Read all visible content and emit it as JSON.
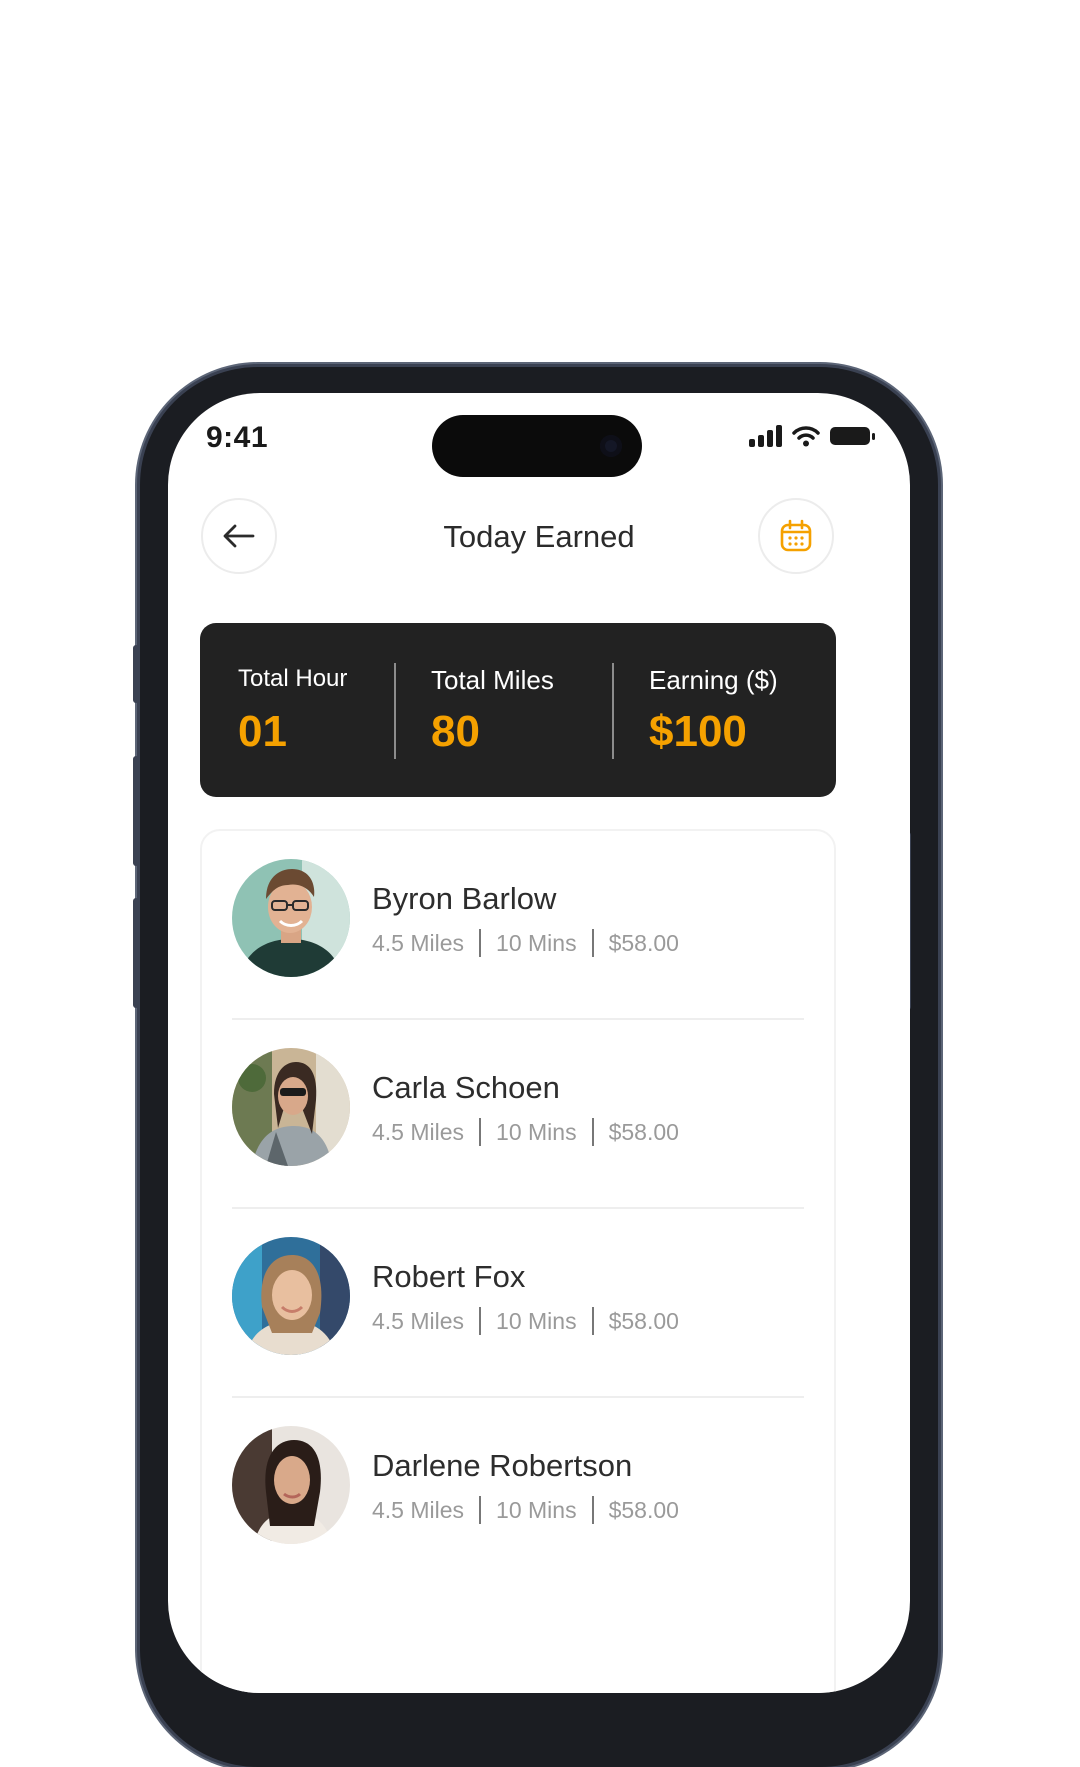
{
  "status_bar": {
    "time": "9:41"
  },
  "header": {
    "title": "Today Earned",
    "back_icon": "arrow-left-icon",
    "calendar_icon": "calendar-icon"
  },
  "colors": {
    "accent": "#F5A100",
    "card_dark": "#222222"
  },
  "stats": [
    {
      "label": "Total Hour",
      "value": "01"
    },
    {
      "label": "Total Miles",
      "value": "80"
    },
    {
      "label": "Earning ($)",
      "value": "$100"
    }
  ],
  "rides": [
    {
      "name": "Byron Barlow",
      "miles": "4.5 Miles",
      "time": "10 Mins",
      "amount": "$58.00"
    },
    {
      "name": "Carla Schoen",
      "miles": "4.5 Miles",
      "time": "10 Mins",
      "amount": "$58.00"
    },
    {
      "name": "Robert Fox",
      "miles": "4.5 Miles",
      "time": "10 Mins",
      "amount": "$58.00"
    },
    {
      "name": "Darlene Robertson",
      "miles": "4.5 Miles",
      "time": "10 Mins",
      "amount": "$58.00"
    }
  ]
}
